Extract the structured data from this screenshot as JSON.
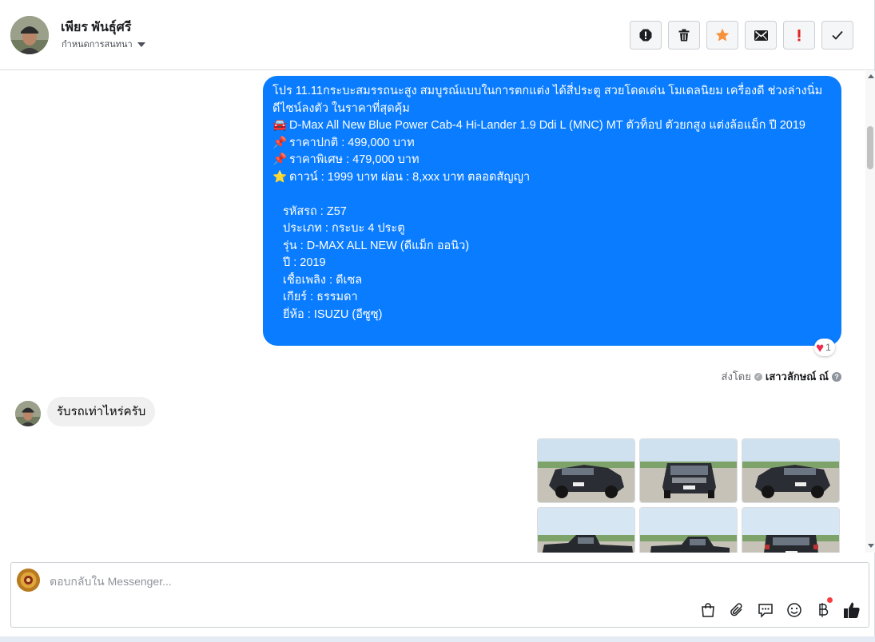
{
  "header": {
    "name": "เพียร พันธุ์ศรี",
    "assign_label": "กำหนดการสนทนา",
    "actions": [
      "spam-icon",
      "trash-icon",
      "star-icon",
      "mail-icon",
      "follow-up-icon",
      "done-icon"
    ]
  },
  "colors": {
    "bubble_out": "#0a7cff",
    "bubble_in": "#f0f0f0",
    "accent": "#f7923a"
  },
  "messages": {
    "outgoing": {
      "line1": "โปร 11.11กระบะสมรรถนะสูง สมบูรณ์แบบในการตกแต่ง ได้สี่ประตู สวยโดดเด่น โมเดลนิยม เครื่องดี ช่วงล่างนิ่ม ดีไซน์ลงตัว ในราคาที่สุดคุ้ม",
      "car_emoji": "🚘",
      "car_title": "D-Max All New Blue Power Cab-4 Hi-Lander 1.9 Ddi L (MNC) MT ตัวท็อป ตัวยกสูง แต่งล้อแม็ก ปี 2019",
      "pin_emoji": "📌",
      "normal_price": "ราคาปกติ : 499,000 บาท",
      "special_price": "ราคาพิเศษ : 479,000 บาท",
      "star_emoji": "⭐",
      "down_payment": "ดาวน์ : 1999 บาท ผ่อน : 8,xxx บาท ตลอดสัญญา",
      "code": "รหัสรถ : Z57",
      "type": "ประเภท : กระบะ 4 ประตู",
      "model": "รุ่น : D-MAX ALL NEW (ดีแม็ก ออนิว)",
      "year": "ปี : 2019",
      "fuel": "เชื้อเพลิง : ดีเซล",
      "gear": "เกียร์ : ธรรมดา",
      "brand": "ยี่ห้อ : ISUZU (อีซูซุ)"
    },
    "reaction": {
      "icon": "heart-icon",
      "count": "1"
    },
    "sent_by": {
      "prefix": "ส่งโดย",
      "name": "เสาวลักษณ์ ณ์"
    },
    "incoming": {
      "text": "รับรถเท่าไหร่ครับ"
    },
    "images": [
      "front-left",
      "front",
      "front-right",
      "side",
      "side-rear",
      "rear"
    ]
  },
  "composer": {
    "placeholder": "ตอบกลับใน Messenger...",
    "tools": [
      "shop-icon",
      "attach-icon",
      "saved-reply-icon",
      "emoji-icon",
      "payment-icon",
      "like-icon"
    ]
  }
}
